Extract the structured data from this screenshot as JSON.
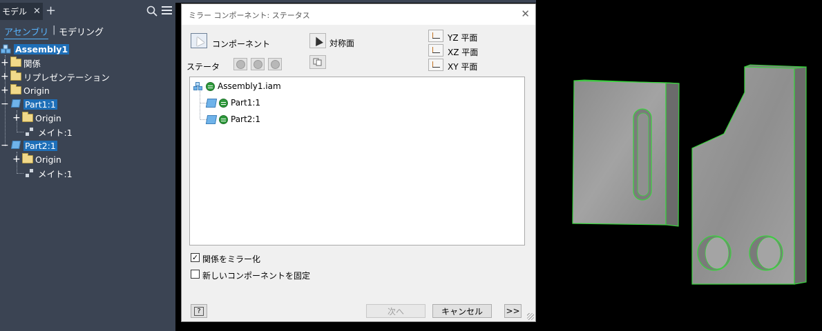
{
  "browser": {
    "tab_label": "モデル",
    "tab_close": "✕",
    "add_tab": "+",
    "mode_assembly": "アセンブリ",
    "mode_separator": "|",
    "mode_modeling": "モデリング",
    "tree": {
      "root": "Assembly1",
      "relations": "関係",
      "representations": "リプレゼンテーション",
      "origin": "Origin",
      "part1": "Part1:1",
      "part1_origin": "Origin",
      "part1_mate": "メイト:1",
      "part2": "Part2:1",
      "part2_origin": "Origin",
      "part2_mate": "メイト:1",
      "expand": "+",
      "collapse": "−"
    }
  },
  "dialog": {
    "title": "ミラー コンポーネント: ステータス",
    "close": "✕",
    "component_label": "コンポーネント",
    "symmetry_label": "対称面",
    "status_label": "ステータ",
    "planes": [
      "YZ 平面",
      "XZ 平面",
      "XY 平面"
    ],
    "list": [
      {
        "name": "Assembly1.iam"
      },
      {
        "name": "Part1:1"
      },
      {
        "name": "Part2:1"
      }
    ],
    "mirror_relations": "関係をミラー化",
    "mirror_relations_checked": "✓",
    "fix_new": "新しいコンポーネントを固定",
    "help": "?",
    "next_button": "次へ",
    "cancel_button": "キャンセル",
    "more_button": ">>"
  },
  "colors": {
    "browser_bg": "#3b4453",
    "highlight": "#1e6fb8",
    "accent_link": "#58b5ff",
    "selection_edge": "#39d43d",
    "part_face": "#9a9a9a"
  }
}
